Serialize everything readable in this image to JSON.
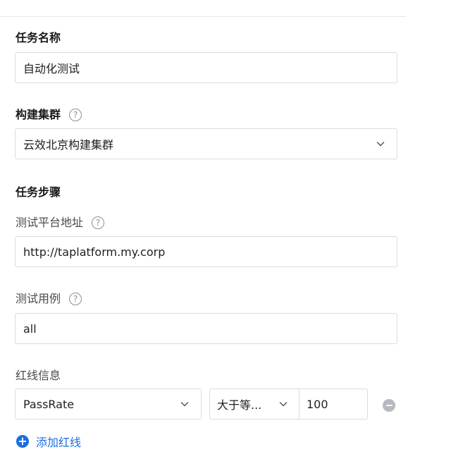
{
  "form": {
    "task_name": {
      "label": "任务名称",
      "value": "自动化测试"
    },
    "build_cluster": {
      "label": "构建集群",
      "help": "?",
      "value": "云效北京构建集群"
    },
    "steps_title": "任务步骤",
    "platform_url": {
      "label": "测试平台地址",
      "help": "?",
      "value": "http://taplatform.my.corp"
    },
    "test_case": {
      "label": "测试用例",
      "help": "?",
      "value": "all"
    },
    "redline": {
      "label": "红线信息",
      "metric": "PassRate",
      "operator": "大于等...",
      "threshold": "100",
      "add_label": "添加红线",
      "add_icon": "+"
    }
  },
  "icons": {
    "help": "question-circle-icon",
    "dropdown": "chevron-down-icon",
    "remove": "minus-circle-icon",
    "add": "plus-circle-icon"
  },
  "colors": {
    "accent": "#1b6fe0",
    "border": "#d9dce1",
    "muted_icon": "#b5b9c0"
  }
}
